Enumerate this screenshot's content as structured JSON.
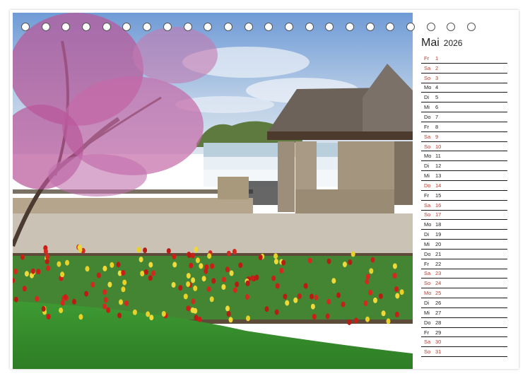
{
  "calendar": {
    "month": "Mai",
    "year": "2026",
    "days": [
      {
        "wd": "Fr",
        "d": "1",
        "red": true
      },
      {
        "wd": "Sa",
        "d": "2",
        "red": true
      },
      {
        "wd": "So",
        "d": "3",
        "red": true
      },
      {
        "wd": "Mo",
        "d": "4",
        "red": false
      },
      {
        "wd": "Di",
        "d": "5",
        "red": false
      },
      {
        "wd": "Mi",
        "d": "6",
        "red": false
      },
      {
        "wd": "Do",
        "d": "7",
        "red": false
      },
      {
        "wd": "Fr",
        "d": "8",
        "red": false
      },
      {
        "wd": "Sa",
        "d": "9",
        "red": true
      },
      {
        "wd": "So",
        "d": "10",
        "red": true
      },
      {
        "wd": "Mo",
        "d": "11",
        "red": false
      },
      {
        "wd": "Di",
        "d": "12",
        "red": false
      },
      {
        "wd": "Mi",
        "d": "13",
        "red": false
      },
      {
        "wd": "Do",
        "d": "14",
        "red": true
      },
      {
        "wd": "Fr",
        "d": "15",
        "red": false
      },
      {
        "wd": "Sa",
        "d": "16",
        "red": true
      },
      {
        "wd": "So",
        "d": "17",
        "red": true
      },
      {
        "wd": "Mo",
        "d": "18",
        "red": false
      },
      {
        "wd": "Di",
        "d": "19",
        "red": false
      },
      {
        "wd": "Mi",
        "d": "20",
        "red": false
      },
      {
        "wd": "Do",
        "d": "21",
        "red": false
      },
      {
        "wd": "Fr",
        "d": "22",
        "red": false
      },
      {
        "wd": "Sa",
        "d": "23",
        "red": true
      },
      {
        "wd": "So",
        "d": "24",
        "red": true
      },
      {
        "wd": "Mo",
        "d": "25",
        "red": true
      },
      {
        "wd": "Di",
        "d": "26",
        "red": false
      },
      {
        "wd": "Mi",
        "d": "27",
        "red": false
      },
      {
        "wd": "Do",
        "d": "28",
        "red": false
      },
      {
        "wd": "Fr",
        "d": "29",
        "red": false
      },
      {
        "wd": "Sa",
        "d": "30",
        "red": true
      },
      {
        "wd": "So",
        "d": "31",
        "red": true
      }
    ]
  },
  "colors": {
    "holiday": "#c0392b",
    "text": "#222222"
  }
}
